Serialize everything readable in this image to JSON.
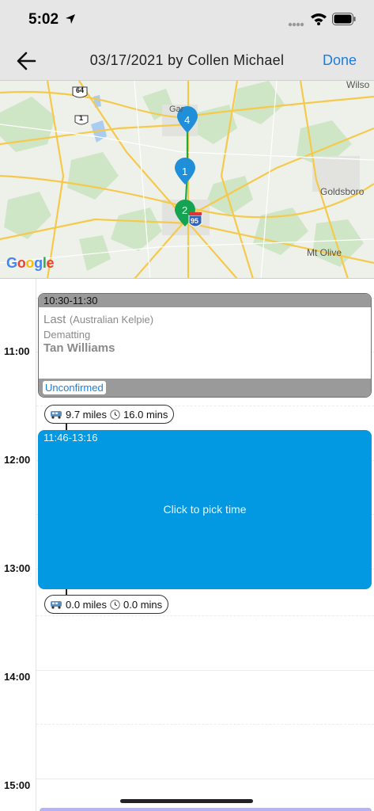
{
  "status_bar": {
    "time": "5:02"
  },
  "nav": {
    "title": "03/17/2021 by Collen Michael",
    "done_label": "Done"
  },
  "map": {
    "labels": {
      "wilso": "Wilso",
      "garner": "Gar",
      "goldsboro": "Goldsboro",
      "mt_olive": "Mt Olive",
      "route_64": "64",
      "route_1": "1",
      "route_95": "95"
    },
    "markers": [
      "4",
      "1",
      "2"
    ],
    "logo": {
      "g1": "G",
      "o1": "o",
      "o2": "o",
      "g2": "g",
      "l": "l",
      "e": "e"
    }
  },
  "calendar": {
    "hours": [
      "11:00",
      "12:00",
      "13:00",
      "14:00",
      "15:00"
    ],
    "appointment": {
      "time_range": "10:30-11:30",
      "pet_name": "Last",
      "breed": "(Australian Kelpie)",
      "service": "Dematting",
      "client": "Tan Williams",
      "status": "Unconfirmed"
    },
    "travel": [
      {
        "distance": "9.7 miles",
        "duration": "16.0 mins"
      },
      {
        "distance": "0.0 miles",
        "duration": "0.0 mins"
      }
    ],
    "pick_slot": {
      "time_range": "11:46-13:16",
      "label": "Click to pick time"
    }
  },
  "colors": {
    "accent": "#1e7dd6",
    "pick_block": "#0298e2",
    "unconfirmed_gray": "#9a9a9a"
  }
}
